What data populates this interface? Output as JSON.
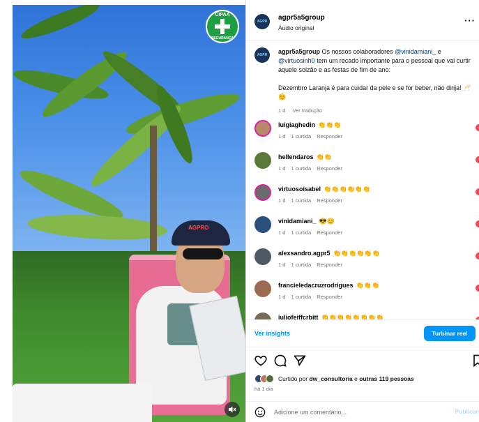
{
  "media": {
    "badge_top": "CIPAA",
    "badge_bottom": "SEGURANÇA",
    "cap_logo": "AGPRO",
    "mute_icon": "speaker-muted-icon"
  },
  "header": {
    "username": "agpr5a5group",
    "subtitle": "Áudio original",
    "more_icon": "···"
  },
  "caption": {
    "username": "agpr5a5group",
    "text_1": "Os nossos colaboradores",
    "mention_1": "@vinidamiani_",
    "text_2": "e",
    "mention_2": "@virtuosinh0",
    "text_3": "tem um recado importante para o pessoal que vai curtir aquele solzão e as festas de fim de ano:",
    "text_4": "Dezembro Laranja é para cuidar da pele e se for beber, não dirija! 🥂 😊",
    "time": "1 d",
    "translate": "Ver tradução"
  },
  "comments": [
    {
      "user": "luigiaghedin",
      "text": "👏👏👏",
      "time": "1 d",
      "likes": "1 curtida",
      "reply": "Responder",
      "avatar_color": "#b88a6a",
      "ring": true
    },
    {
      "user": "hellendaros",
      "text": "👏👏",
      "time": "1 d",
      "likes": "1 curtida",
      "reply": "Responder",
      "avatar_color": "#5b7a3a",
      "ring": false
    },
    {
      "user": "virtuosoisabel",
      "text": "👏👏👏👏👏👏",
      "time": "1 d",
      "likes": "1 curtida",
      "reply": "Responder",
      "avatar_color": "#6c6c6c",
      "ring": true
    },
    {
      "user": "vinidamiani_",
      "text": "😎😊",
      "time": "1 d",
      "likes": "1 curtida",
      "reply": "Responder",
      "avatar_color": "#2a4f7a",
      "ring": false
    },
    {
      "user": "alexsandro.agpr5",
      "text": "👏👏👏👏👏👏",
      "time": "1 d",
      "likes": "1 curtida",
      "reply": "Responder",
      "avatar_color": "#4d5a66",
      "ring": false
    },
    {
      "user": "francieledacruzrodrigues",
      "text": "👏👏👏",
      "time": "1 d",
      "likes": "1 curtida",
      "reply": "Responder",
      "avatar_color": "#9a6b52",
      "ring": false
    },
    {
      "user": "juliofeiffcrbitt",
      "text": "👏👏👏👏👏👏👏👏",
      "time": "",
      "likes": "",
      "reply": "",
      "avatar_color": "#7a6a5a",
      "ring": false
    }
  ],
  "insights": {
    "link": "Ver insights",
    "boost": "Turbinar reel"
  },
  "likes": {
    "prefix": "Curtido por",
    "user": "dw_consultoria",
    "mid": "e",
    "others": "outras 119 pessoas",
    "ago": "há 1 dia"
  },
  "add_comment": {
    "placeholder": "Adicione um comentário...",
    "post": "Publicar"
  },
  "colors": {
    "link": "#0095f6",
    "muted": "#737373",
    "heart": "#ed4956"
  }
}
